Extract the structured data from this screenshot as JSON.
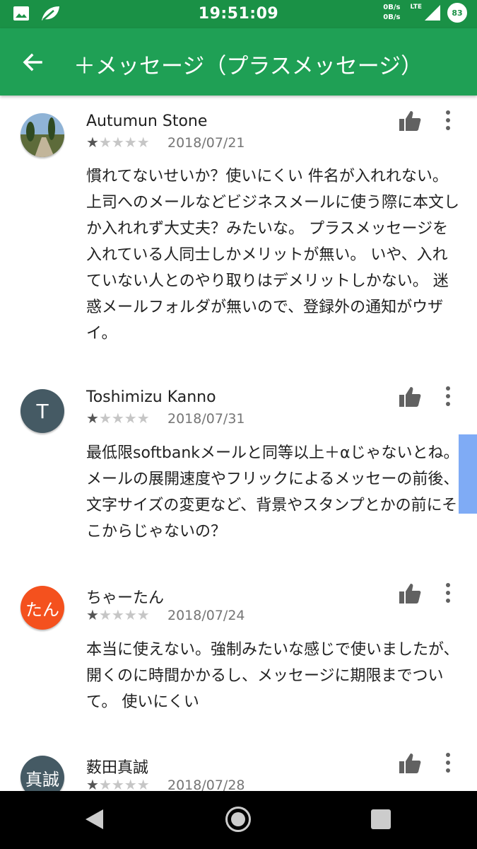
{
  "status_bar": {
    "time": "19:51:09",
    "net_up": "0B/s",
    "net_down": "0B/s",
    "network": "LTE",
    "battery": "83",
    "icons": [
      "image-icon",
      "leaf-icon",
      "signal-icon"
    ]
  },
  "app_bar": {
    "title": "＋メッセージ（プラスメッセージ）",
    "back_icon": "arrow-back-icon",
    "color": "#1fa055"
  },
  "reviews": [
    {
      "author": "Autumun Stone",
      "rating": 1,
      "stars": "★★★★★",
      "date": "2018/07/21",
      "avatar": "photo",
      "text": "慣れてないせいか？使いにくい 件名が入れれない。 上司へのメールなどビジネスメールに使う際に本文しか入れれず大丈夫？みたいな。 プラスメッセージを入れている人同士しかメリットが無い。 いや、入れていない人とのやり取りはデメリットしかない。 迷惑メールフォルダが無いので、登録外の通知がウザイ。"
    },
    {
      "author": "Toshimizu Kanno",
      "rating": 1,
      "stars": "★★★★★",
      "date": "2018/07/31",
      "avatar": "T",
      "avatar_color": "#455a64",
      "text": "最低限softbankメールと同等以上＋αじゃないとね。 メールの展開速度やフリックによるメッセーの前後、文字サイズの変更など、背景やスタンプとかの前にそこからじゃないの？"
    },
    {
      "author": "ちゃーたん",
      "rating": 1,
      "stars": "★★★★★",
      "date": "2018/07/24",
      "avatar": "たん",
      "avatar_color": "#f4511e",
      "text": "本当に使えない。強制みたいな感じで使いましたが、開くのに時間かかるし、メッセージに期限までついて。 使いにくい"
    },
    {
      "author": "薮田真誠",
      "rating": 1,
      "stars": "★★★★★",
      "date": "2018/07/28",
      "avatar": "真誠",
      "avatar_color": "#455a64",
      "text": ""
    }
  ],
  "nav_bar": {
    "icons": [
      "nav-back-icon",
      "nav-home-icon",
      "nav-recent-icon"
    ]
  }
}
